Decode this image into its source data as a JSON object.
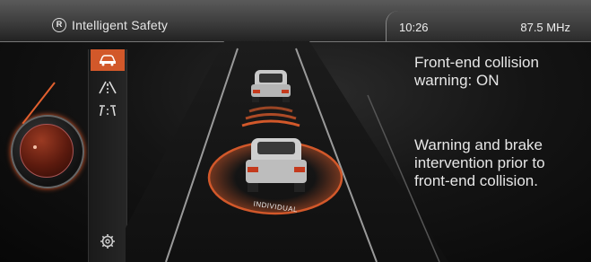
{
  "header": {
    "title_icon": "R",
    "title": "Intelligent Safety",
    "clock": "10:26",
    "radio": "87.5 MHz"
  },
  "menu": [
    {
      "icon": "car-icon",
      "selected": true
    },
    {
      "icon": "lane-warning-icon",
      "selected": false
    },
    {
      "icon": "lane-crossing-icon",
      "selected": false
    },
    {
      "icon": "gear-icon",
      "selected": false
    }
  ],
  "info": {
    "status_line1": "Front-end collision",
    "status_line2": "warning: ON",
    "desc_line1": "Warning and brake",
    "desc_line2": "intervention prior to",
    "desc_line3": "front-end collision."
  },
  "graphic": {
    "badge": "INDIVIDUAL"
  },
  "colors": {
    "accent": "#d2582a",
    "background": "#141414",
    "text": "#e6e6e6"
  }
}
